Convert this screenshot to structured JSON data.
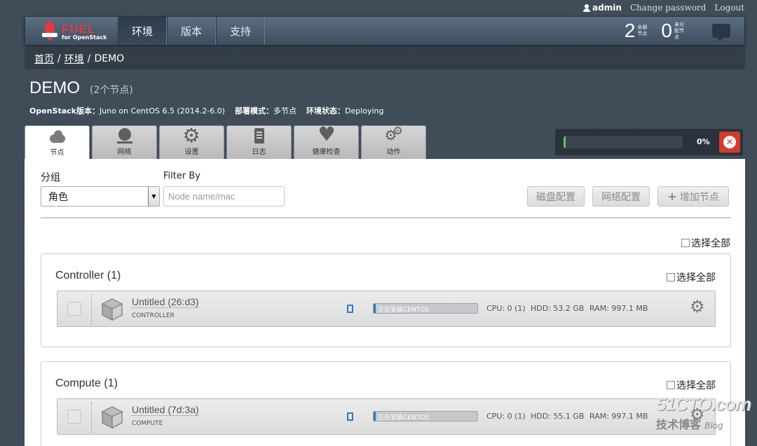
{
  "userbar": {
    "user": "admin",
    "change_password": "Change password",
    "logout": "Logout"
  },
  "logo": {
    "title": "FUEL",
    "subtitle": "for OpenStack"
  },
  "nav": {
    "tabs": [
      "环境",
      "版本",
      "支持"
    ],
    "active": 0
  },
  "stats": [
    {
      "value": "2",
      "label": "全部节点"
    },
    {
      "value": "0",
      "label": "未分配节点"
    }
  ],
  "breadcrumb": {
    "home": "首页",
    "env": "环境",
    "sep": "/",
    "current": "DEMO"
  },
  "env": {
    "name": "DEMO",
    "count": "(2个节点)",
    "version_label": "OpenStack版本：",
    "version": "Juno on CentOS 6.5 (2014.2-6.0)",
    "mode_label": "部署模式：",
    "mode": "多节点",
    "status_label": "环境状态：",
    "status": "Deploying"
  },
  "tabs": [
    {
      "label": "节点",
      "icon": "cloud-icon"
    },
    {
      "label": "网络",
      "icon": "globe-icon"
    },
    {
      "label": "设置",
      "icon": "gear-icon"
    },
    {
      "label": "日志",
      "icon": "clipboard-icon"
    },
    {
      "label": "健康检查",
      "icon": "heart-icon"
    },
    {
      "label": "动作",
      "icon": "gears-icon"
    }
  ],
  "progress": {
    "percent_label": "0%",
    "value": 0.02,
    "bar_color": "#5ccf4c"
  },
  "controls": {
    "group_label": "分组",
    "group_value": "角色",
    "filter_label": "Filter By",
    "filter_placeholder": "Node name/mac",
    "disk_btn": "磁盘配置",
    "network_btn": "网络配置",
    "add_btn": "增加节点",
    "select_all": "选择全部"
  },
  "groups": [
    {
      "title": "Controller (1)",
      "select_all": "选择全部",
      "node": {
        "name": "Untitled (26:d3)",
        "role": "CONTROLLER",
        "status": "正在安装CENTOS",
        "progress": 0.02,
        "cpu": "CPU: 0 (1)",
        "hdd": "HDD: 53.2 GB",
        "ram": "RAM: 997.1 MB"
      }
    },
    {
      "title": "Compute (1)",
      "select_all": "选择全部",
      "node": {
        "name": "Untitled (7d:3a)",
        "role": "COMPUTE",
        "status": "正在安装CENTOS",
        "progress": 0.02,
        "cpu": "CPU: 0 (1)",
        "hdd": "HDD: 55.1 GB",
        "ram": "RAM: 997.1 MB"
      }
    }
  ],
  "watermark": {
    "site": "51CTO.com",
    "cn": "技术博客",
    "blog": "Blog"
  }
}
